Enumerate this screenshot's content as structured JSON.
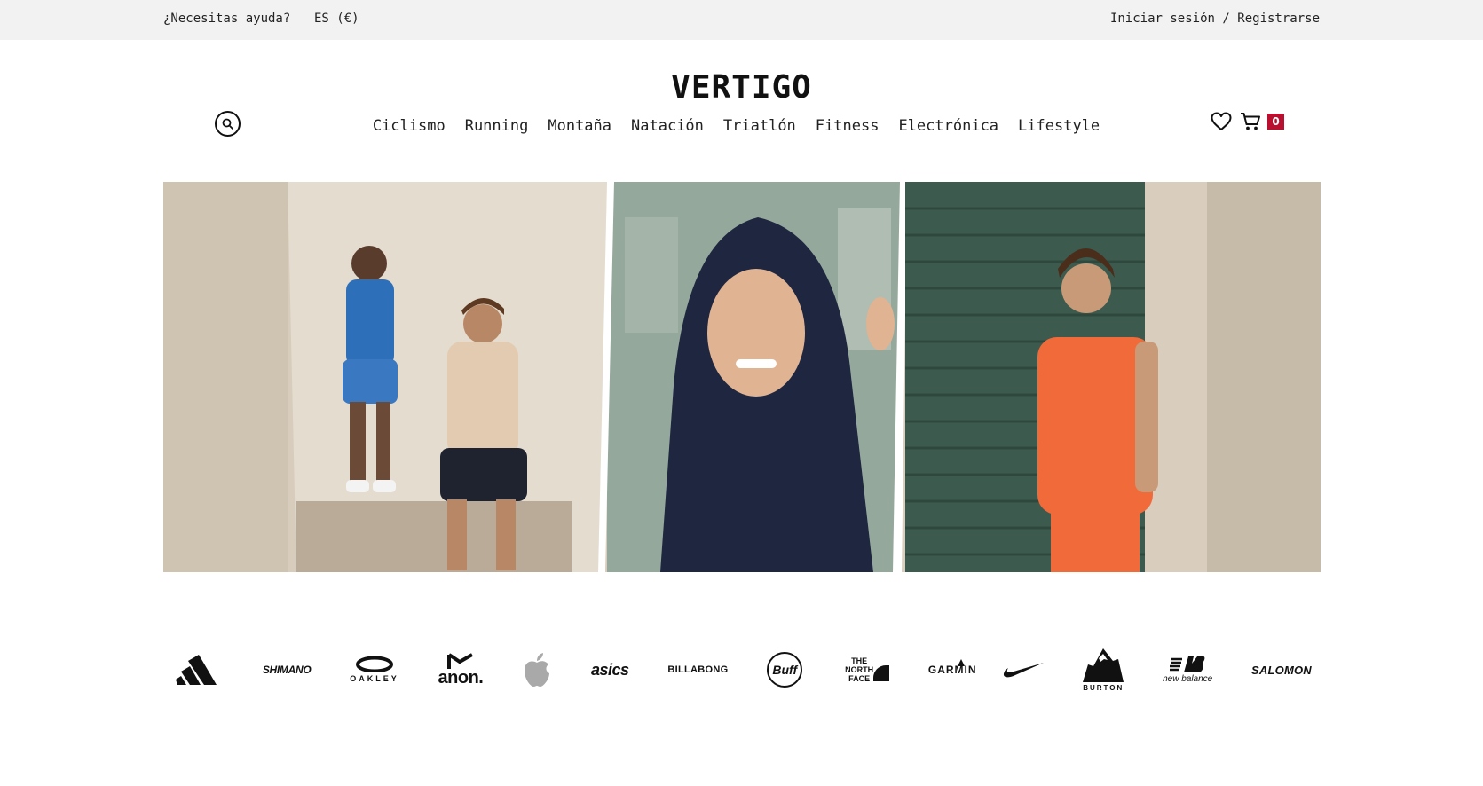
{
  "topbar": {
    "help": "¿Necesitas ayuda?",
    "language": "ES (€)",
    "login": "Iniciar sesión",
    "separator": "/",
    "register": "Registrarse"
  },
  "header": {
    "logo": "VERTIGO",
    "search_icon": "search-icon",
    "wishlist_icon": "heart-icon",
    "cart_icon": "cart-icon",
    "cart_count": "0",
    "cart_badge_color": "#b8102e"
  },
  "nav": {
    "items": [
      "Ciclismo",
      "Running",
      "Montaña",
      "Natación",
      "Triatlón",
      "Fitness",
      "Electrónica",
      "Lifestyle"
    ]
  },
  "hero": {
    "image": "hero-banner-photo-collage"
  },
  "brands": {
    "items": [
      {
        "name": "adidas-logo",
        "text": ""
      },
      {
        "name": "shimano-logo",
        "text": "SHIMANO"
      },
      {
        "name": "oakley-logo",
        "text": "OAKLEY"
      },
      {
        "name": "anon-logo",
        "text": "anon."
      },
      {
        "name": "apple-logo",
        "text": ""
      },
      {
        "name": "asics-logo",
        "text": "asics"
      },
      {
        "name": "billabong-logo",
        "text": "BILLABONG"
      },
      {
        "name": "buff-logo",
        "text": "Buff"
      },
      {
        "name": "the-north-face-logo",
        "text": "THE NORTH FACE"
      },
      {
        "name": "garmin-logo",
        "text": "GARMIN"
      },
      {
        "name": "nike-logo",
        "text": ""
      },
      {
        "name": "burton-logo",
        "text": "BURTON"
      },
      {
        "name": "new-balance-logo",
        "text": "new balance"
      },
      {
        "name": "salomon-logo",
        "text": "SALOMON"
      }
    ]
  }
}
